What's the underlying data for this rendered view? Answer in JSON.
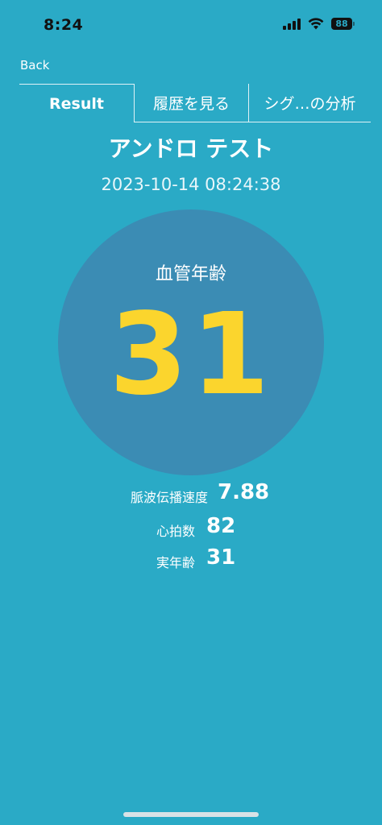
{
  "status_bar": {
    "time": "8:24",
    "battery": "88",
    "icons": [
      "signal-icon",
      "wifi-icon",
      "battery-icon"
    ]
  },
  "nav": {
    "back_label": "Back"
  },
  "tabs": [
    {
      "label": "Result",
      "active": true
    },
    {
      "label": "履歴を見る",
      "active": false
    },
    {
      "label": "シグ…の分析",
      "active": false
    }
  ],
  "header": {
    "title": "アンドロ テスト",
    "timestamp": "2023-10-14 08:24:38"
  },
  "result": {
    "label": "血管年齢",
    "value": "31"
  },
  "metrics": [
    {
      "label": "脈波伝播速度",
      "value": "7.88"
    },
    {
      "label": "心拍数",
      "value": "82"
    },
    {
      "label": "実年齢",
      "value": "31"
    }
  ],
  "colors": {
    "background": "#2aaac6",
    "circle": "#3b8cb4",
    "accent": "#fbd52d",
    "text": "#ffffff"
  }
}
